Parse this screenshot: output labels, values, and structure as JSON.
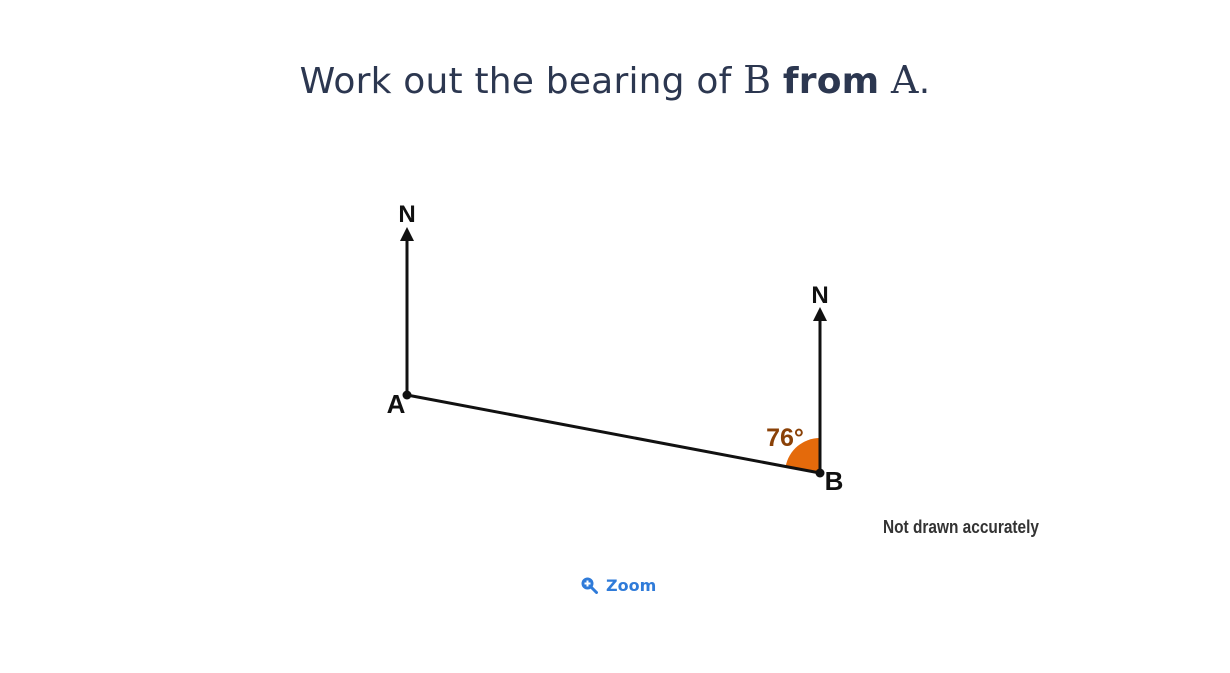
{
  "question": {
    "prefix": "Work out the bearing of",
    "point_to": "B",
    "connector": "from",
    "point_from": "A",
    "suffix": "."
  },
  "diagram": {
    "north_label_a": "N",
    "north_label_b": "N",
    "point_a_label": "A",
    "point_b_label": "B",
    "angle_label": "76°",
    "angle_value_degrees": 76,
    "note": "Not drawn accurately",
    "colors": {
      "line": "#111111",
      "angle_fill": "#e46a0b",
      "angle_text": "#8a4107",
      "note_text": "#333333"
    }
  },
  "zoom": {
    "label": "Zoom",
    "icon": "zoom-in-magnifier-icon",
    "color": "#2f7bd9"
  }
}
